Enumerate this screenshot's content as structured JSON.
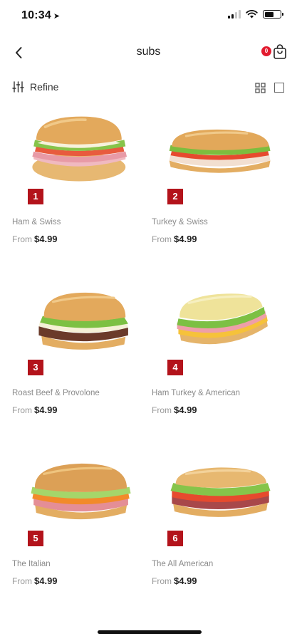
{
  "status": {
    "time": "10:34",
    "location_glyph": "➤"
  },
  "nav": {
    "title": "subs",
    "cart_count": "0"
  },
  "toolbar": {
    "refine_label": "Refine"
  },
  "products": [
    {
      "number": "1",
      "name": "Ham & Swiss",
      "price_prefix": "From",
      "price": "$4.99"
    },
    {
      "number": "2",
      "name": "Turkey & Swiss",
      "price_prefix": "From",
      "price": "$4.99"
    },
    {
      "number": "3",
      "name": "Roast Beef & Provolone",
      "price_prefix": "From",
      "price": "$4.99"
    },
    {
      "number": "4",
      "name": "Ham Turkey & American",
      "price_prefix": "From",
      "price": "$4.99"
    },
    {
      "number": "5",
      "name": "The Italian",
      "price_prefix": "From",
      "price": "$4.99"
    },
    {
      "number": "6",
      "name": "The All American",
      "price_prefix": "From",
      "price": "$4.99"
    }
  ],
  "colors": {
    "accent_red": "#b3131b",
    "badge_red": "#e21b2f",
    "bread": "#e9b86a",
    "lettuce": "#7cc043",
    "meat": "#e8a0a8",
    "beef": "#6b3a2a"
  }
}
